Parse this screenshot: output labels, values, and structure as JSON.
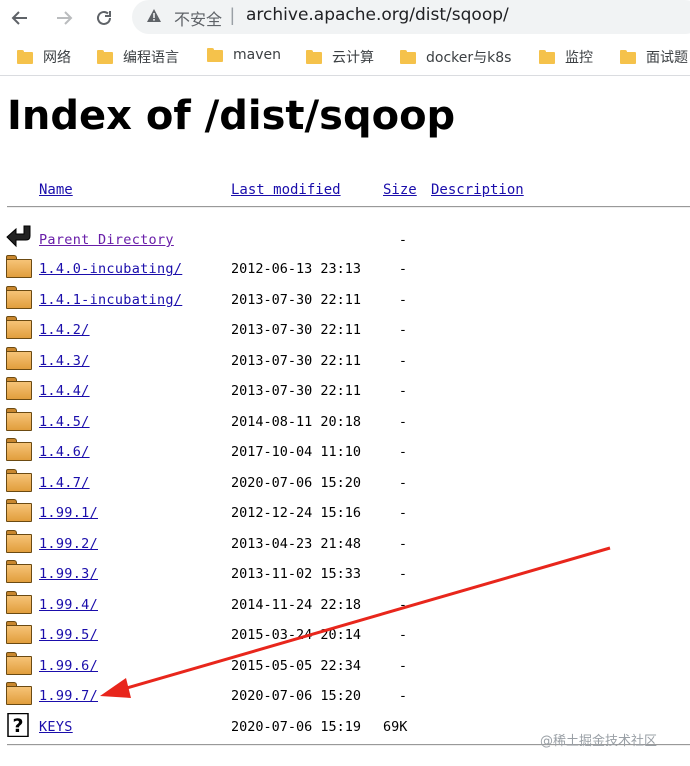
{
  "browser": {
    "security_label": "不安全",
    "separator": "|",
    "url": "archive.apache.org/dist/sqoop/"
  },
  "bookmarks": [
    {
      "label": "网络"
    },
    {
      "label": "编程语言"
    },
    {
      "label": "maven"
    },
    {
      "label": "云计算"
    },
    {
      "label": "docker与k8s"
    },
    {
      "label": "监控"
    },
    {
      "label": "面试题"
    }
  ],
  "page": {
    "title": "Index of /dist/sqoop",
    "columns": {
      "name": "Name",
      "last_modified": "Last modified",
      "size": "Size",
      "description": "Description"
    },
    "parent": {
      "name": "Parent Directory",
      "size": "-"
    },
    "entries": [
      {
        "name": "1.4.0-incubating/",
        "modified": "2012-06-13 23:13",
        "size": "-",
        "icon": "folder-icon"
      },
      {
        "name": "1.4.1-incubating/",
        "modified": "2013-07-30 22:11",
        "size": "-",
        "icon": "folder-icon"
      },
      {
        "name": "1.4.2/",
        "modified": "2013-07-30 22:11",
        "size": "-",
        "icon": "folder-icon"
      },
      {
        "name": "1.4.3/",
        "modified": "2013-07-30 22:11",
        "size": "-",
        "icon": "folder-icon"
      },
      {
        "name": "1.4.4/",
        "modified": "2013-07-30 22:11",
        "size": "-",
        "icon": "folder-icon"
      },
      {
        "name": "1.4.5/",
        "modified": "2014-08-11 20:18",
        "size": "-",
        "icon": "folder-icon"
      },
      {
        "name": "1.4.6/",
        "modified": "2017-10-04 11:10",
        "size": "-",
        "icon": "folder-icon"
      },
      {
        "name": "1.4.7/",
        "modified": "2020-07-06 15:20",
        "size": "-",
        "icon": "folder-icon"
      },
      {
        "name": "1.99.1/",
        "modified": "2012-12-24 15:16",
        "size": "-",
        "icon": "folder-icon"
      },
      {
        "name": "1.99.2/",
        "modified": "2013-04-23 21:48",
        "size": "-",
        "icon": "folder-icon"
      },
      {
        "name": "1.99.3/",
        "modified": "2013-11-02 15:33",
        "size": "-",
        "icon": "folder-icon"
      },
      {
        "name": "1.99.4/",
        "modified": "2014-11-24 22:18",
        "size": "-",
        "icon": "folder-icon"
      },
      {
        "name": "1.99.5/",
        "modified": "2015-03-24 20:14",
        "size": "-",
        "icon": "folder-icon"
      },
      {
        "name": "1.99.6/",
        "modified": "2015-05-05 22:34",
        "size": "-",
        "icon": "folder-icon"
      },
      {
        "name": "1.99.7/",
        "modified": "2020-07-06 15:20",
        "size": "-",
        "icon": "folder-icon"
      },
      {
        "name": "KEYS",
        "modified": "2020-07-06 15:19",
        "size": "69K",
        "icon": "unknown-file-icon"
      }
    ]
  },
  "annotation": {
    "color": "#e8261c"
  },
  "watermark": "@稀土掘金技术社区"
}
